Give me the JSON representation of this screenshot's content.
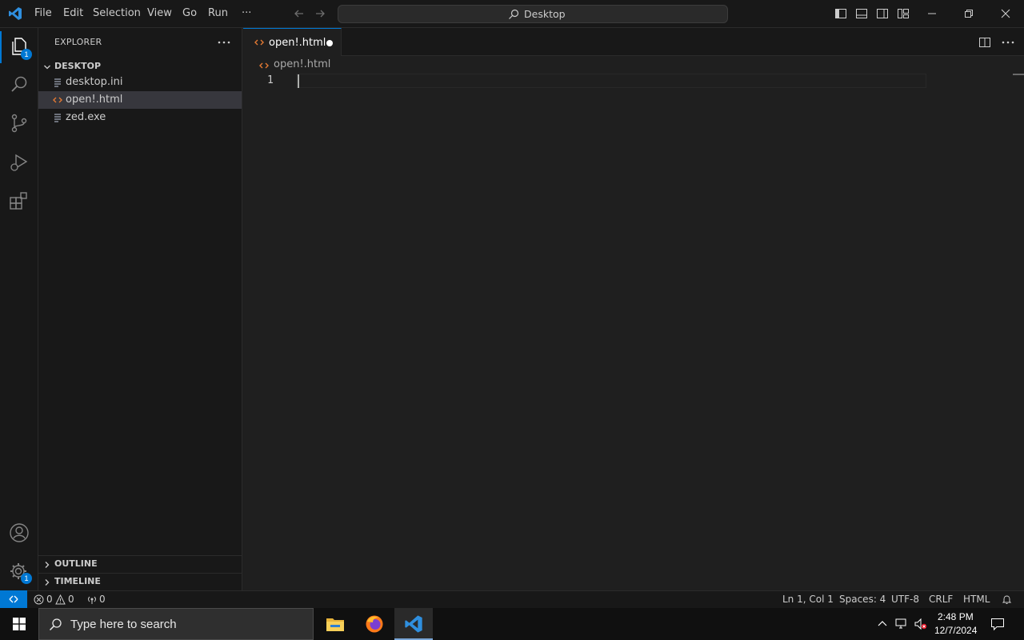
{
  "titlebar": {
    "menu": [
      "File",
      "Edit",
      "Selection",
      "View",
      "Go",
      "Run",
      "···"
    ],
    "command_center": "Desktop"
  },
  "activity": {
    "explorer_badge": "1",
    "settings_badge": "1"
  },
  "sidebar": {
    "title": "EXPLORER",
    "more": "···",
    "folder": "DESKTOP",
    "files": [
      {
        "name": "desktop.ini",
        "icon": "text-file-icon"
      },
      {
        "name": "open!.html",
        "icon": "html-file-icon"
      },
      {
        "name": "zed.exe",
        "icon": "text-file-icon"
      }
    ],
    "outline": "OUTLINE",
    "timeline": "TIMELINE"
  },
  "editor": {
    "tab_label": "open!.html",
    "breadcrumb": "open!.html",
    "line_number": "1",
    "more": "···"
  },
  "status": {
    "errors": "0",
    "warnings": "0",
    "ports": "0",
    "position": "Ln 1, Col 1",
    "spaces": "Spaces: 4",
    "encoding": "UTF-8",
    "eol": "CRLF",
    "language": "HTML"
  },
  "taskbar": {
    "search_placeholder": "Type here to search",
    "time": "2:48 PM",
    "date": "12/7/2024"
  },
  "colors": {
    "accent": "#0078d4",
    "background": "#1f1f1f",
    "sidebar": "#181818",
    "html_icon": "#e37933"
  }
}
